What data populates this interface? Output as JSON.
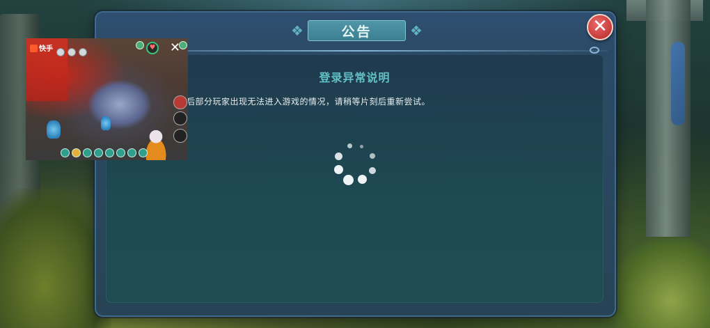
{
  "dialog": {
    "title": "公告",
    "close_label": "✕",
    "heading": "登录异常说明",
    "body": "后部分玩家出现无法进入游戏的情况，请稍等片刻后重新尝试。"
  },
  "loading": {
    "state": "loading",
    "icon": "spinner-icon"
  },
  "pip_overlay": {
    "app_logo": "快手",
    "close_label": "✕"
  },
  "colors": {
    "panel": "#2b4a66",
    "heading_teal": "#62c1c7",
    "title_banner": "#4f96a8",
    "close_red": "#c43a3a"
  }
}
